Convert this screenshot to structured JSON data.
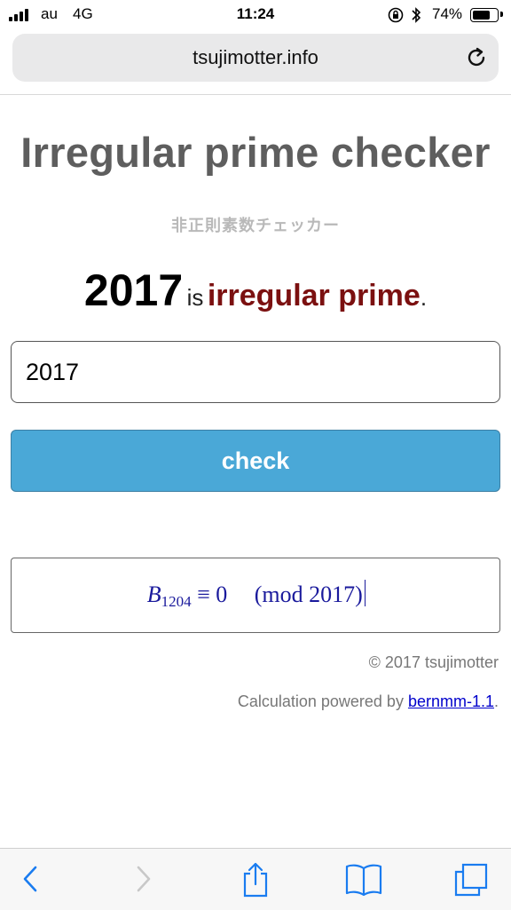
{
  "status": {
    "carrier": "au",
    "network": "4G",
    "time": "11:24",
    "battery_pct": "74%",
    "battery_level": 0.74,
    "icons": [
      "signal-bars-icon",
      "orientation-lock-icon",
      "bluetooth-icon",
      "battery-icon"
    ]
  },
  "browser": {
    "url": "tsujimotter.info",
    "reload_icon": "reload-icon",
    "toolbar_icons": [
      "back-icon",
      "forward-icon",
      "share-icon",
      "bookmarks-icon",
      "tabs-icon"
    ]
  },
  "page": {
    "title": "Irregular prime checker",
    "subtitle": "非正則素数チェッカー",
    "result": {
      "number": "2017",
      "is": "is",
      "kind": "irregular prime",
      "period": "."
    },
    "input_value": "2017",
    "check_label": "check",
    "formula": {
      "bernoulli": "B",
      "index": "1204",
      "relation": "≡ 0",
      "modulus": "(mod  2017)"
    },
    "copyright": "© 2017 tsujimotter",
    "powered_prefix": "Calculation powered by ",
    "powered_link": "bernmm-1.1",
    "powered_suffix": "."
  },
  "colors": {
    "title": "#5e5e5e",
    "subtitle": "#b9b9b9",
    "irregular": "#7b1010",
    "button": "#4aa8d7",
    "formula": "#1a1a9c",
    "link": "#0000cc",
    "toolbar_icon": "#1a7cf0"
  }
}
